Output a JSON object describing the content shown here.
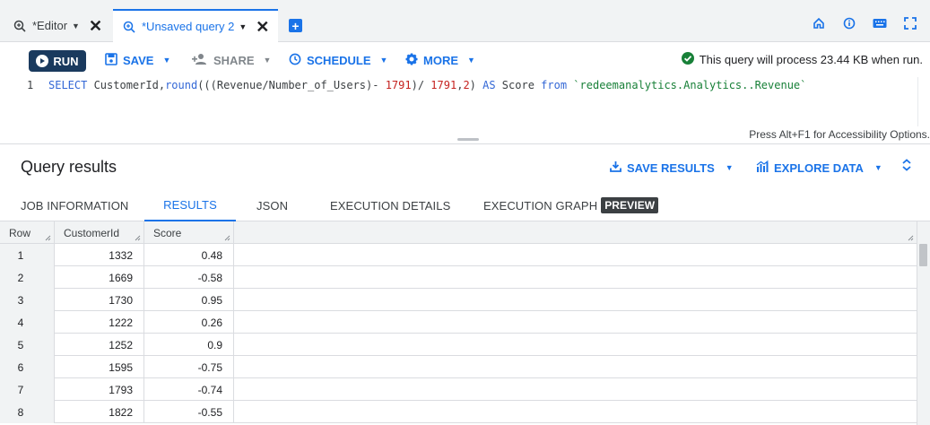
{
  "tabs": [
    {
      "label": "*Editor",
      "active": false
    },
    {
      "label": "*Unsaved query 2",
      "active": true
    }
  ],
  "add_tab_label": "+",
  "toolbar": {
    "run_label": "RUN",
    "save_label": "SAVE",
    "share_label": "SHARE",
    "schedule_label": "SCHEDULE",
    "more_label": "MORE",
    "process_message": "This query will process 23.44 KB when run."
  },
  "editor": {
    "line_number": "1",
    "code_tokens": [
      {
        "text": "SELECT",
        "kind": "kw"
      },
      {
        "text": " CustomerId,",
        "kind": "plain"
      },
      {
        "text": "round",
        "kind": "fn"
      },
      {
        "text": "(((Revenue/Number_of_Users)- ",
        "kind": "plain"
      },
      {
        "text": "1791",
        "kind": "num"
      },
      {
        "text": ")/ ",
        "kind": "plain"
      },
      {
        "text": "1791",
        "kind": "num"
      },
      {
        "text": ",",
        "kind": "plain"
      },
      {
        "text": "2",
        "kind": "num"
      },
      {
        "text": ") ",
        "kind": "plain"
      },
      {
        "text": "AS",
        "kind": "kw"
      },
      {
        "text": " Score ",
        "kind": "plain"
      },
      {
        "text": "from",
        "kind": "kw"
      },
      {
        "text": " ",
        "kind": "plain"
      },
      {
        "text": "`redeemanalytics.Analytics..Revenue`",
        "kind": "str"
      }
    ],
    "accessibility_hint": "Press Alt+F1 for Accessibility Options."
  },
  "results": {
    "title": "Query results",
    "save_results_label": "SAVE RESULTS",
    "explore_data_label": "EXPLORE DATA",
    "tabs": [
      {
        "label": "JOB INFORMATION"
      },
      {
        "label": "RESULTS"
      },
      {
        "label": "JSON"
      },
      {
        "label": "EXECUTION DETAILS"
      },
      {
        "label": "EXECUTION GRAPH"
      }
    ],
    "preview_badge": "PREVIEW",
    "columns": [
      "Row",
      "CustomerId",
      "Score"
    ],
    "rows": [
      {
        "row": "1",
        "customer_id": "1332",
        "score": "0.48"
      },
      {
        "row": "2",
        "customer_id": "1669",
        "score": "-0.58"
      },
      {
        "row": "3",
        "customer_id": "1730",
        "score": "0.95"
      },
      {
        "row": "4",
        "customer_id": "1222",
        "score": "0.26"
      },
      {
        "row": "5",
        "customer_id": "1252",
        "score": "0.9"
      },
      {
        "row": "6",
        "customer_id": "1595",
        "score": "-0.75"
      },
      {
        "row": "7",
        "customer_id": "1793",
        "score": "-0.74"
      },
      {
        "row": "8",
        "customer_id": "1822",
        "score": "-0.55"
      }
    ]
  },
  "colors": {
    "accent": "#1a73e8",
    "run_button": "#1a3a5e",
    "success": "#188038"
  }
}
